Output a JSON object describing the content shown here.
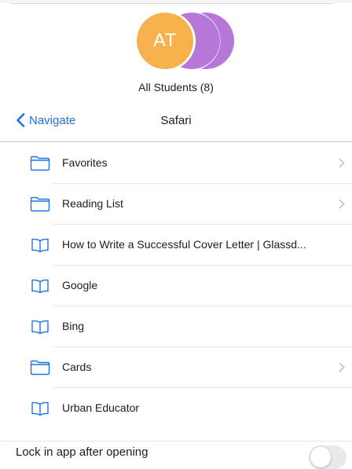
{
  "group": {
    "front_initials": "AT",
    "label": "All Students (8)"
  },
  "nav": {
    "back_label": "Navigate",
    "title": "Safari"
  },
  "items": [
    {
      "label": "Favorites",
      "icon": "folder-icon",
      "chevron": true
    },
    {
      "label": "Reading List",
      "icon": "folder-icon",
      "chevron": true
    },
    {
      "label": "How to Write a Successful Cover Letter | Glassd...",
      "icon": "book-icon",
      "chevron": false
    },
    {
      "label": "Google",
      "icon": "book-icon",
      "chevron": false
    },
    {
      "label": "Bing",
      "icon": "book-icon",
      "chevron": false
    },
    {
      "label": "Cards",
      "icon": "folder-icon",
      "chevron": true
    },
    {
      "label": "Urban Educator",
      "icon": "book-icon",
      "chevron": false
    }
  ],
  "lock": {
    "label": "Lock in app after opening",
    "enabled": false
  },
  "colors": {
    "accent": "#1a73e8",
    "avatar_orange": "#f5b24c",
    "avatar_purple": "#b777d9",
    "toggle_off": "#e9e9eb"
  }
}
